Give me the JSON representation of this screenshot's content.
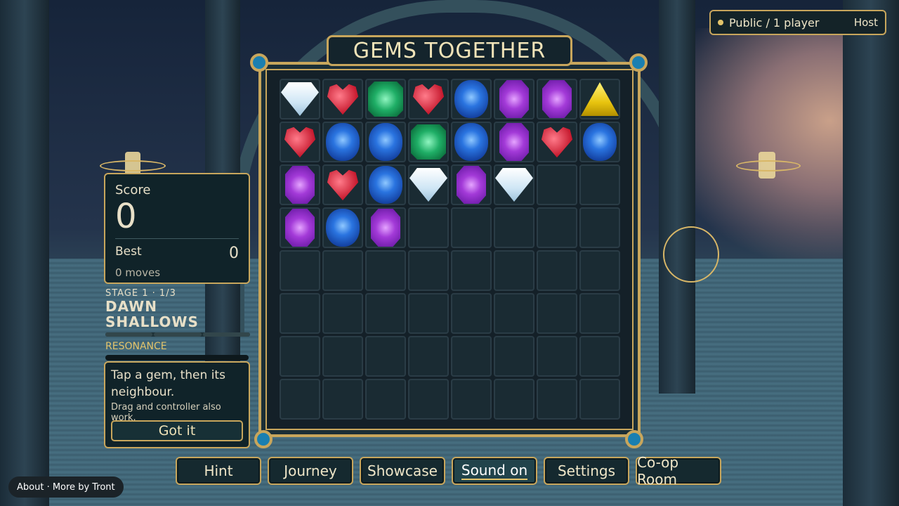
{
  "title": "GEMS TOGETHER",
  "session": {
    "status": "Public / 1 player",
    "role": "Host"
  },
  "score": {
    "label": "Score",
    "value": "0",
    "best_label": "Best",
    "best_value": "0",
    "moves": "0 moves"
  },
  "stage": {
    "label": "STAGE 1 · 1/3",
    "name": "DAWN SHALLOWS",
    "resonance_label": "RESONANCE"
  },
  "tutorial": {
    "text": "Tap a gem, then its neighbour.",
    "subtext": "Drag and controller also work.",
    "button": "Got it"
  },
  "nav": {
    "hint": "Hint",
    "journey": "Journey",
    "showcase": "Showcase",
    "sound": "Sound on",
    "settings": "Settings",
    "coop": "Co-op Room"
  },
  "footer": {
    "about": "About · More by Tront"
  },
  "colors": {
    "gold": "#c8a65c",
    "panel": "#102329"
  },
  "board": {
    "rows": 8,
    "cols": 8,
    "gems": [
      [
        "white",
        "heart",
        "green",
        "heart",
        "blue",
        "purple",
        "purple",
        "yellow"
      ],
      [
        "heart",
        "blue",
        "blue",
        "green",
        "blue",
        "purple",
        "heart",
        "blue"
      ],
      [
        "purple",
        "heart",
        "blue",
        "white",
        "purple",
        "white",
        "",
        ""
      ],
      [
        "purple",
        "blue",
        "purple",
        "",
        "",
        "",
        "",
        ""
      ],
      [
        "",
        "",
        "",
        "",
        "",
        "",
        "",
        ""
      ],
      [
        "",
        "",
        "",
        "",
        "",
        "",
        "",
        ""
      ],
      [
        "",
        "",
        "",
        "",
        "",
        "",
        "",
        ""
      ],
      [
        "",
        "",
        "",
        "",
        "",
        "",
        "",
        ""
      ]
    ]
  }
}
